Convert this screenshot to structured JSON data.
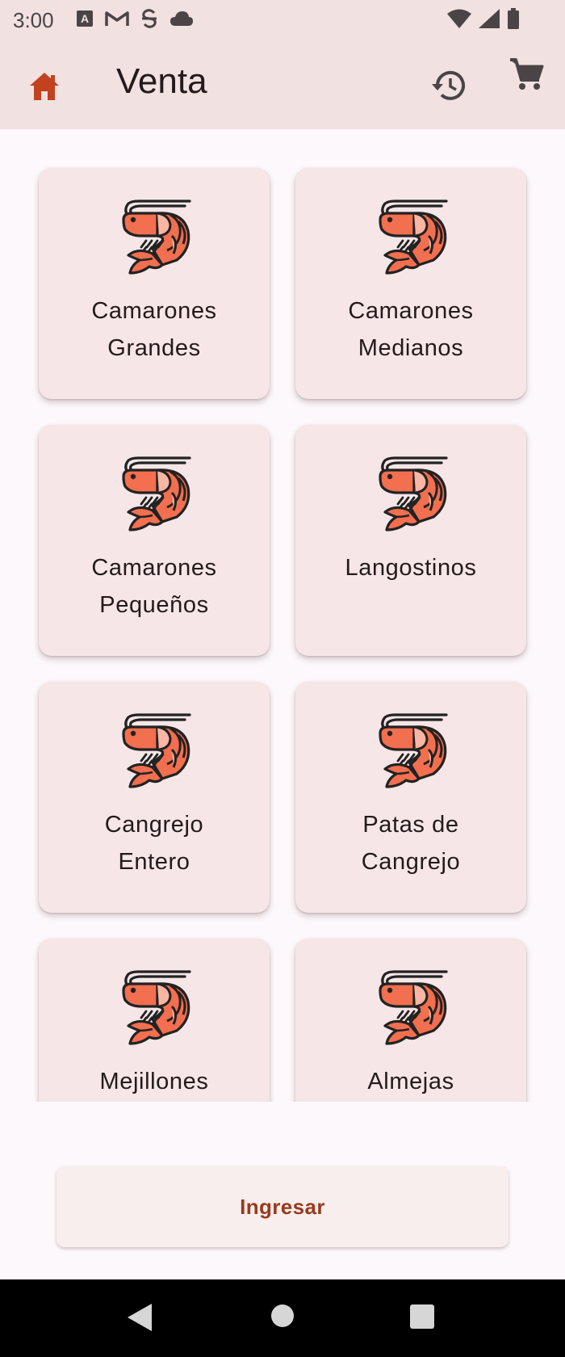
{
  "status_bar": {
    "time": "3:00",
    "left_icons": [
      "autofill-icon",
      "gmail-icon",
      "sync-icon",
      "cloud-icon"
    ],
    "right_icons": [
      "wifi-icon",
      "signal-icon",
      "battery-icon"
    ]
  },
  "app_bar": {
    "title": "Venta",
    "home_icon": "home-icon",
    "history_icon": "history-icon",
    "cart_icon": "cart-icon"
  },
  "products": [
    {
      "label": "Camarones\nGrandes",
      "icon": "shrimp-icon"
    },
    {
      "label": "Camarones\nMedianos",
      "icon": "shrimp-icon"
    },
    {
      "label": "Camarones\nPequeños",
      "icon": "shrimp-icon"
    },
    {
      "label": "Langostinos",
      "icon": "shrimp-icon"
    },
    {
      "label": "Cangrejo\nEntero",
      "icon": "shrimp-icon"
    },
    {
      "label": "Patas de\nCangrejo",
      "icon": "shrimp-icon"
    },
    {
      "label": "Mejillones",
      "icon": "shrimp-icon"
    },
    {
      "label": "Almejas",
      "icon": "shrimp-icon"
    }
  ],
  "bottom_button": {
    "label": "Ingresar"
  },
  "nav_bar": {
    "icons": [
      "back-icon",
      "home-circle-icon",
      "recent-apps-icon"
    ]
  },
  "colors": {
    "header_bg": "#f1e1e0",
    "card_bg": "#f6e6e7",
    "accent": "#9a3a1c",
    "shrimp": "#f26f4f",
    "page_bg": "#fdf8fb"
  }
}
